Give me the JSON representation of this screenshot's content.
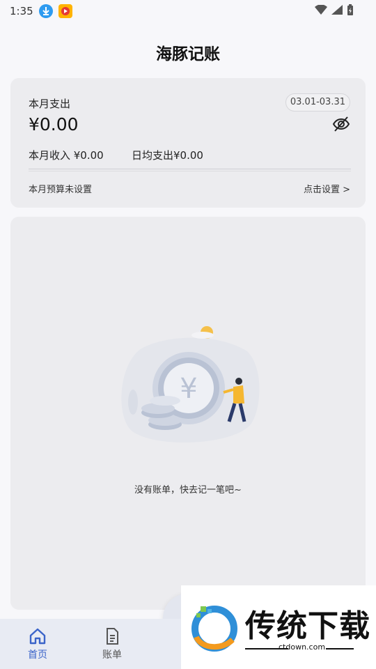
{
  "status_bar": {
    "time": "1:35"
  },
  "header": {
    "title": "海豚记账"
  },
  "summary": {
    "expense_label": "本月支出",
    "date_range": "03.01-03.31",
    "expense_amount": "¥0.00",
    "income_text": "本月收入 ¥0.00",
    "daily_text": "日均支出¥0.00",
    "budget_text": "本月预算未设置",
    "budget_link": "点击设置 >"
  },
  "bill_list": {
    "empty_text": "没有账单，快去记一笔吧~"
  },
  "tabbar": {
    "tabs": [
      {
        "label": "首页",
        "icon": "home-icon",
        "active": true
      },
      {
        "label": "账单",
        "icon": "document-icon",
        "active": false
      }
    ]
  },
  "watermark": {
    "title": "传统下载",
    "domain": "ctdown.com"
  },
  "colors": {
    "accent": "#3b64c9",
    "card_bg": "#ececef",
    "page_bg": "#f7f7fa"
  }
}
